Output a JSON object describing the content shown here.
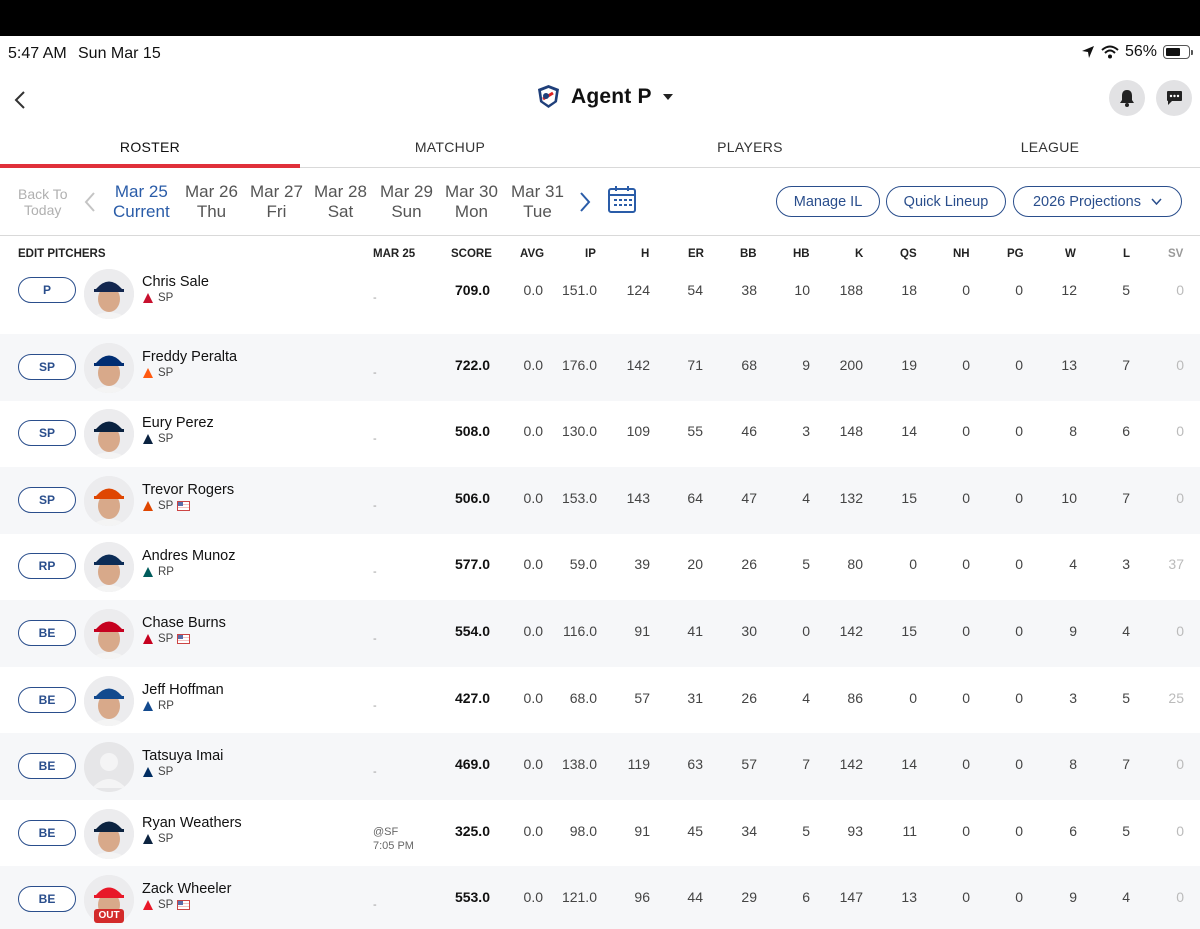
{
  "status": {
    "time": "5:47 AM",
    "date": "Sun Mar 15",
    "battery": "56%"
  },
  "header": {
    "team_name": "Agent P"
  },
  "tabs": [
    {
      "label": "ROSTER",
      "active": true
    },
    {
      "label": "MATCHUP",
      "active": false
    },
    {
      "label": "PLAYERS",
      "active": false
    },
    {
      "label": "LEAGUE",
      "active": false
    }
  ],
  "datebar": {
    "back_today_line1": "Back To",
    "back_today_line2": "Today",
    "days": [
      {
        "date": "Mar 25",
        "dow": "Current",
        "current": true
      },
      {
        "date": "Mar 26",
        "dow": "Thu"
      },
      {
        "date": "Mar 27",
        "dow": "Fri"
      },
      {
        "date": "Mar 28",
        "dow": "Sat"
      },
      {
        "date": "Mar 29",
        "dow": "Sun"
      },
      {
        "date": "Mar 30",
        "dow": "Mon"
      },
      {
        "date": "Mar 31",
        "dow": "Tue"
      }
    ],
    "manage_il": "Manage IL",
    "quick_lineup": "Quick Lineup",
    "projections": "2026 Projections"
  },
  "table": {
    "columns": [
      "EDIT PITCHERS",
      "MAR 25",
      "SCORE",
      "AVG",
      "IP",
      "H",
      "ER",
      "BB",
      "HB",
      "K",
      "QS",
      "NH",
      "PG",
      "W",
      "L",
      "SV"
    ],
    "rows": [
      {
        "slot": "P",
        "name": "Chris Sale",
        "team_logo": "braves-logo",
        "pos": "SP",
        "flag": false,
        "out": false,
        "opp": "-",
        "opp_time": "",
        "score": "709.0",
        "avg": "0.0",
        "ip": "151.0",
        "h": "124",
        "er": "54",
        "bb": "38",
        "hb": "10",
        "k": "188",
        "qs": "18",
        "nh": "0",
        "pg": "0",
        "w": "12",
        "l": "5",
        "sv": "0"
      },
      {
        "slot": "SP",
        "name": "Freddy Peralta",
        "team_logo": "mets-logo",
        "pos": "SP",
        "flag": false,
        "out": false,
        "opp": "-",
        "opp_time": "",
        "score": "722.0",
        "avg": "0.0",
        "ip": "176.0",
        "h": "142",
        "er": "71",
        "bb": "68",
        "hb": "9",
        "k": "200",
        "qs": "19",
        "nh": "0",
        "pg": "0",
        "w": "13",
        "l": "7",
        "sv": "0"
      },
      {
        "slot": "SP",
        "name": "Eury Perez",
        "team_logo": "marlins-logo",
        "pos": "SP",
        "flag": false,
        "out": false,
        "opp": "-",
        "opp_time": "",
        "score": "508.0",
        "avg": "0.0",
        "ip": "130.0",
        "h": "109",
        "er": "55",
        "bb": "46",
        "hb": "3",
        "k": "148",
        "qs": "14",
        "nh": "0",
        "pg": "0",
        "w": "8",
        "l": "6",
        "sv": "0"
      },
      {
        "slot": "SP",
        "name": "Trevor Rogers",
        "team_logo": "orioles-logo",
        "pos": "SP",
        "flag": true,
        "out": false,
        "opp": "-",
        "opp_time": "",
        "score": "506.0",
        "avg": "0.0",
        "ip": "153.0",
        "h": "143",
        "er": "64",
        "bb": "47",
        "hb": "4",
        "k": "132",
        "qs": "15",
        "nh": "0",
        "pg": "0",
        "w": "10",
        "l": "7",
        "sv": "0"
      },
      {
        "slot": "RP",
        "name": "Andres Munoz",
        "team_logo": "mariners-logo",
        "pos": "RP",
        "flag": false,
        "out": false,
        "opp": "-",
        "opp_time": "",
        "score": "577.0",
        "avg": "0.0",
        "ip": "59.0",
        "h": "39",
        "er": "20",
        "bb": "26",
        "hb": "5",
        "k": "80",
        "qs": "0",
        "nh": "0",
        "pg": "0",
        "w": "4",
        "l": "3",
        "sv": "37"
      },
      {
        "slot": "BE",
        "name": "Chase Burns",
        "team_logo": "reds-logo",
        "pos": "SP",
        "flag": true,
        "out": false,
        "opp": "-",
        "opp_time": "",
        "score": "554.0",
        "avg": "0.0",
        "ip": "116.0",
        "h": "91",
        "er": "41",
        "bb": "30",
        "hb": "0",
        "k": "142",
        "qs": "15",
        "nh": "0",
        "pg": "0",
        "w": "9",
        "l": "4",
        "sv": "0"
      },
      {
        "slot": "BE",
        "name": "Jeff Hoffman",
        "team_logo": "bluejays-logo",
        "pos": "RP",
        "flag": false,
        "out": false,
        "opp": "-",
        "opp_time": "",
        "score": "427.0",
        "avg": "0.0",
        "ip": "68.0",
        "h": "57",
        "er": "31",
        "bb": "26",
        "hb": "4",
        "k": "86",
        "qs": "0",
        "nh": "0",
        "pg": "0",
        "w": "3",
        "l": "5",
        "sv": "25"
      },
      {
        "slot": "BE",
        "name": "Tatsuya Imai",
        "team_logo": "astros-logo",
        "pos": "SP",
        "flag": false,
        "out": false,
        "opp": "-",
        "opp_time": "",
        "score": "469.0",
        "avg": "0.0",
        "ip": "138.0",
        "h": "119",
        "er": "63",
        "bb": "57",
        "hb": "7",
        "k": "142",
        "qs": "14",
        "nh": "0",
        "pg": "0",
        "w": "8",
        "l": "7",
        "sv": "0"
      },
      {
        "slot": "BE",
        "name": "Ryan Weathers",
        "team_logo": "yankees-logo",
        "pos": "SP",
        "flag": false,
        "out": false,
        "opp": "@SF",
        "opp_time": "7:05 PM",
        "score": "325.0",
        "avg": "0.0",
        "ip": "98.0",
        "h": "91",
        "er": "45",
        "bb": "34",
        "hb": "5",
        "k": "93",
        "qs": "11",
        "nh": "0",
        "pg": "0",
        "w": "6",
        "l": "5",
        "sv": "0"
      },
      {
        "slot": "BE",
        "name": "Zack Wheeler",
        "team_logo": "phillies-logo",
        "pos": "SP",
        "flag": true,
        "out": true,
        "out_label": "OUT",
        "opp": "-",
        "opp_time": "",
        "score": "553.0",
        "avg": "0.0",
        "ip": "121.0",
        "h": "96",
        "er": "44",
        "bb": "29",
        "hb": "6",
        "k": "147",
        "qs": "13",
        "nh": "0",
        "pg": "0",
        "w": "9",
        "l": "4",
        "sv": "0"
      }
    ]
  },
  "colors": {
    "accent_red": "#e0303a",
    "link_blue": "#2a4e8c",
    "current_day": "#2a5ca8"
  }
}
